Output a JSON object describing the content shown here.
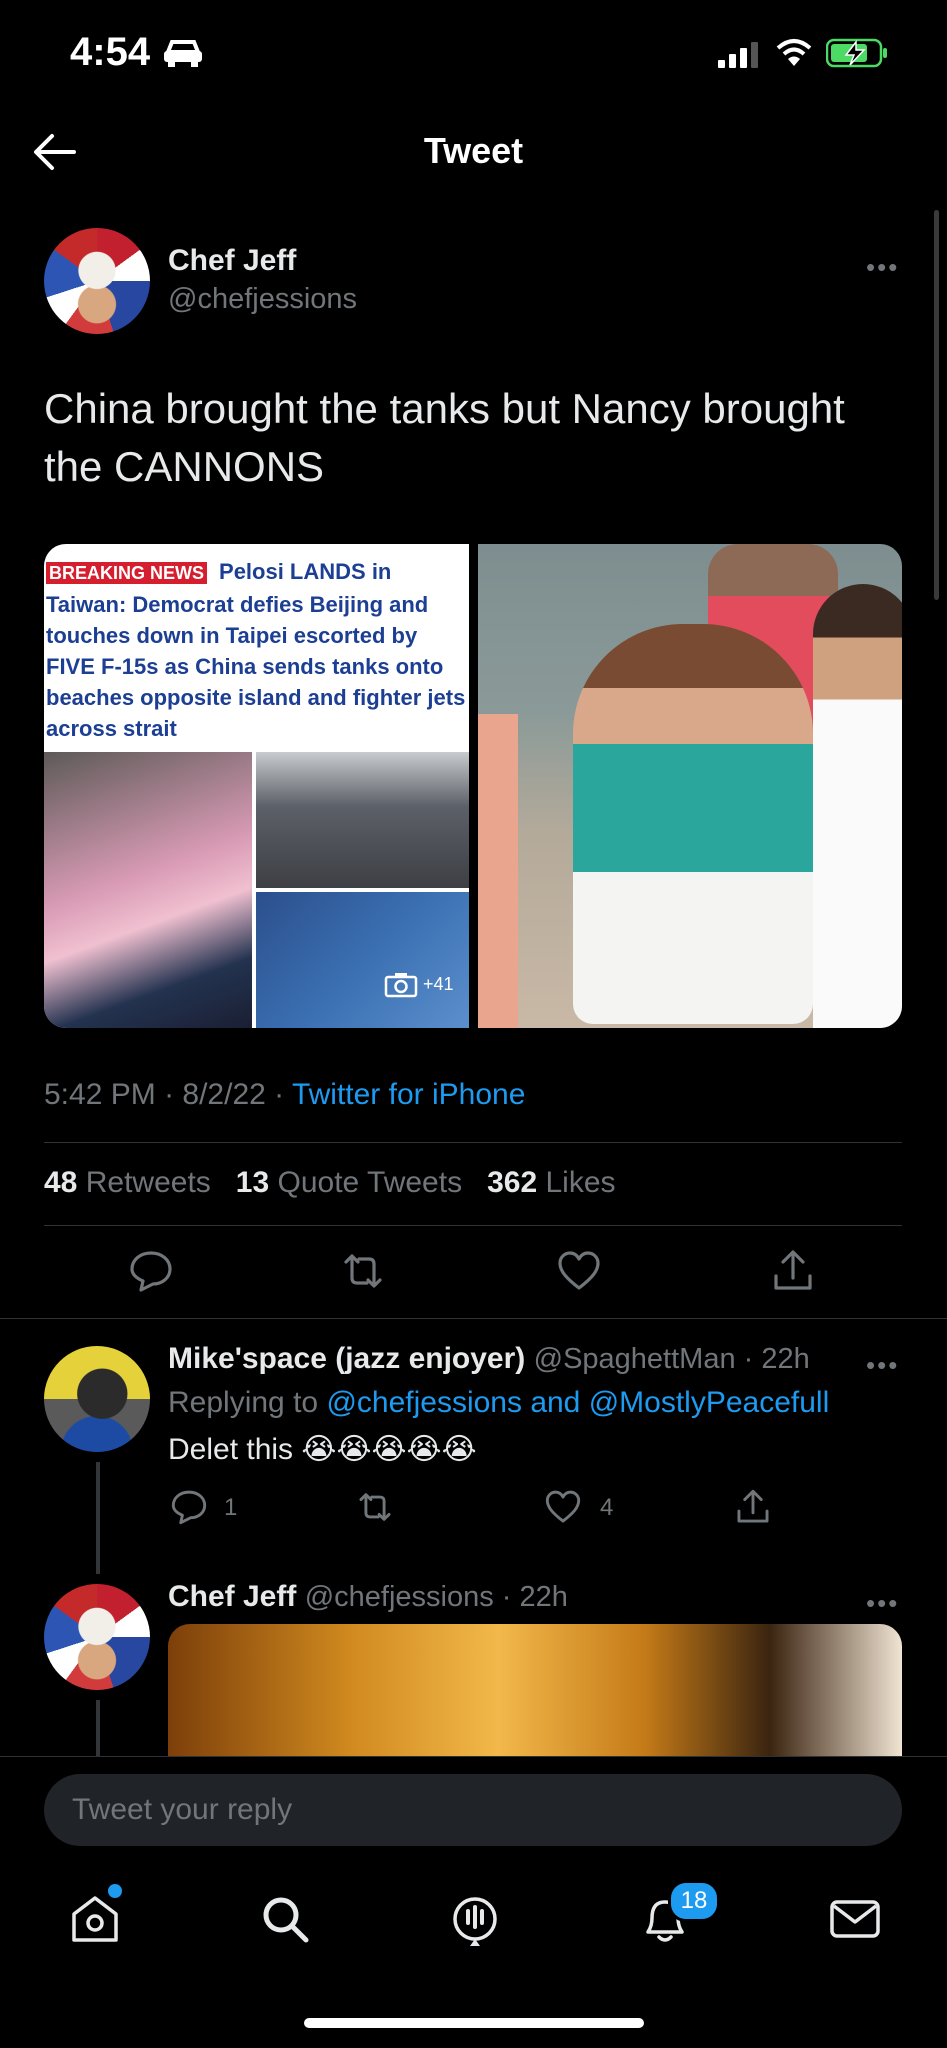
{
  "status_bar": {
    "time": "4:54"
  },
  "header": {
    "title": "Tweet"
  },
  "tweet": {
    "author_name": "Chef Jeff",
    "author_handle": "@chefjessions",
    "text": "China brought the tanks but Nancy brought the CANNONS",
    "media": {
      "breaking_label": "BREAKING NEWS",
      "headline": "Pelosi LANDS in Taiwan: Democrat defies Beijing and touches down in Taipei escorted by FIVE F-15s as China sends tanks onto beaches opposite island and fighter jets across strait",
      "photo_count": "+41"
    },
    "time": "5:42 PM",
    "date": "8/2/22",
    "source": "Twitter for iPhone",
    "stats": {
      "retweets_count": "48",
      "retweets_label": "Retweets",
      "quotes_count": "13",
      "quotes_label": "Quote Tweets",
      "likes_count": "362",
      "likes_label": "Likes"
    }
  },
  "reply_1": {
    "author_name": "Mike'space (jazz enjoyer)",
    "author_handle": "@SpaghettMan",
    "age": "22h",
    "replying_prefix": "Replying to",
    "replying_to": "@chefjessions and @MostlyPeacefull",
    "text": "Delet this 😭😭😭😭😭",
    "reply_count": "1",
    "like_count": "4"
  },
  "reply_2": {
    "author_name": "Chef Jeff",
    "author_handle": "@chefjessions",
    "age": "22h"
  },
  "composer": {
    "placeholder": "Tweet your reply"
  },
  "tab_bar": {
    "notifications_badge": "18"
  },
  "colors": {
    "accent": "#1d9bf0",
    "background": "#000000",
    "muted": "#71767b"
  }
}
